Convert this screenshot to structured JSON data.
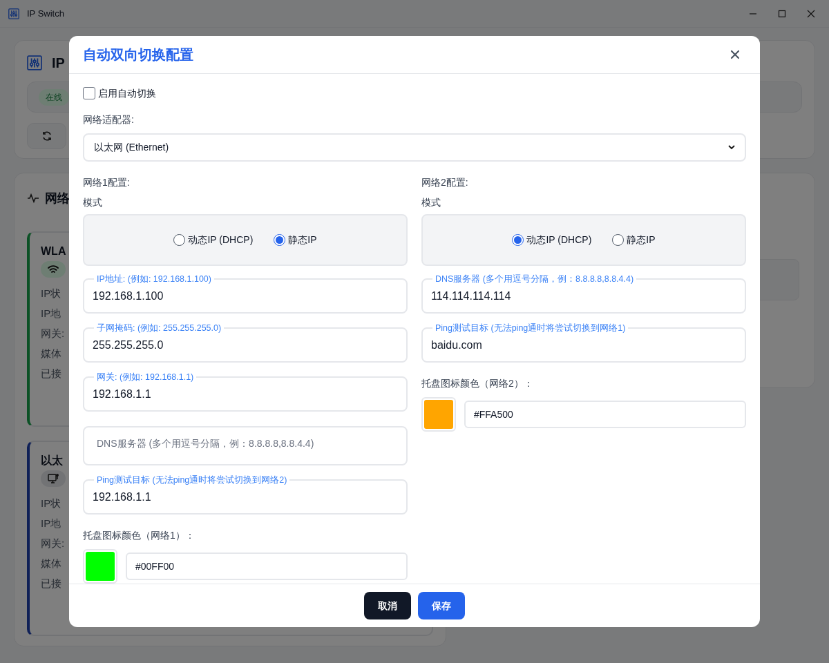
{
  "window": {
    "title": "IP Switch"
  },
  "background": {
    "header": {
      "title": "IP"
    },
    "status": {
      "badge": "在线"
    },
    "networks": {
      "title": "网络",
      "cards": [
        {
          "name": "WLA",
          "kind": "wifi",
          "lines": [
            "IP状",
            "IP地",
            "网关:",
            "媒体",
            "已接"
          ]
        },
        {
          "name": "以太",
          "kind": "ethernet",
          "lines": [
            "IP状",
            "IP地",
            "网关:",
            "媒体",
            "已接"
          ]
        }
      ]
    }
  },
  "dialog": {
    "title": "自动双向切换配置",
    "auto_switch": {
      "label": "启用自动切换",
      "checked": false
    },
    "adapter": {
      "label": "网络适配器:",
      "value": "以太网 (Ethernet)"
    },
    "networks": [
      {
        "title": "网络1配置:",
        "mode_label": "模式",
        "modes": [
          {
            "label": "动态IP (DHCP)",
            "selected": false
          },
          {
            "label": "静态IP",
            "selected": true
          }
        ],
        "fields": [
          {
            "legend": "IP地址: (例如: 192.168.1.100)",
            "value": "192.168.1.100"
          },
          {
            "legend": "子网掩码: (例如: 255.255.255.0)",
            "value": "255.255.255.0"
          },
          {
            "legend": "网关: (例如: 192.168.1.1)",
            "value": "192.168.1.1"
          },
          {
            "placeholder": "DNS服务器 (多个用逗号分隔，例：8.8.8.8,8.8.4.4)"
          },
          {
            "legend": "Ping测试目标 (无法ping通时将尝试切换到网络2)",
            "value": "192.168.1.1"
          }
        ],
        "color_label": "托盘图标颜色（网络1）：",
        "color": "#00FF00",
        "color_value": "#00FF00"
      },
      {
        "title": "网络2配置:",
        "mode_label": "模式",
        "modes": [
          {
            "label": "动态IP (DHCP)",
            "selected": true
          },
          {
            "label": "静态IP",
            "selected": false
          }
        ],
        "fields": [
          {
            "legend": "DNS服务器 (多个用逗号分隔，例：8.8.8.8,8.8.4.4)",
            "value": "114.114.114.114"
          },
          {
            "legend": "Ping测试目标 (无法ping通时将尝试切换到网络1)",
            "value": "baidu.com"
          }
        ],
        "color_label": "托盘图标颜色（网络2）：",
        "color": "#FFA500",
        "color_value": "#FFA500"
      }
    ],
    "buttons": [
      {
        "label": "取消",
        "kind": "cancel"
      },
      {
        "label": "保存",
        "kind": "primary"
      }
    ]
  }
}
